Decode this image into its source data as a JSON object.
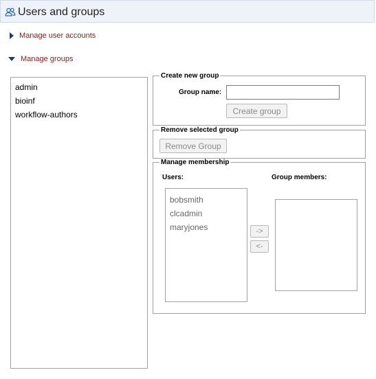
{
  "header": {
    "title": "Users and groups",
    "icon": "users-icon"
  },
  "sections": {
    "manage_user_accounts": "Manage user accounts",
    "manage_groups": "Manage groups"
  },
  "groups": [
    "admin",
    "bioinf",
    "workflow-authors"
  ],
  "create_group": {
    "legend": "Create new group",
    "name_label": "Group name:",
    "name_value": "",
    "button": "Create group"
  },
  "remove_group": {
    "legend": "Remove selected group",
    "button": "Remove Group"
  },
  "membership": {
    "legend": "Manage membership",
    "users_label": "Users:",
    "members_label": "Group members:",
    "users": [
      "bobsmith",
      "clcadmin",
      "maryjones"
    ],
    "members": [],
    "add_button": "->",
    "remove_button": "<-"
  },
  "colors": {
    "section_link": "#8b1a1a",
    "header_bg": "#eef3fa",
    "triangle": "#1f3a6b"
  }
}
